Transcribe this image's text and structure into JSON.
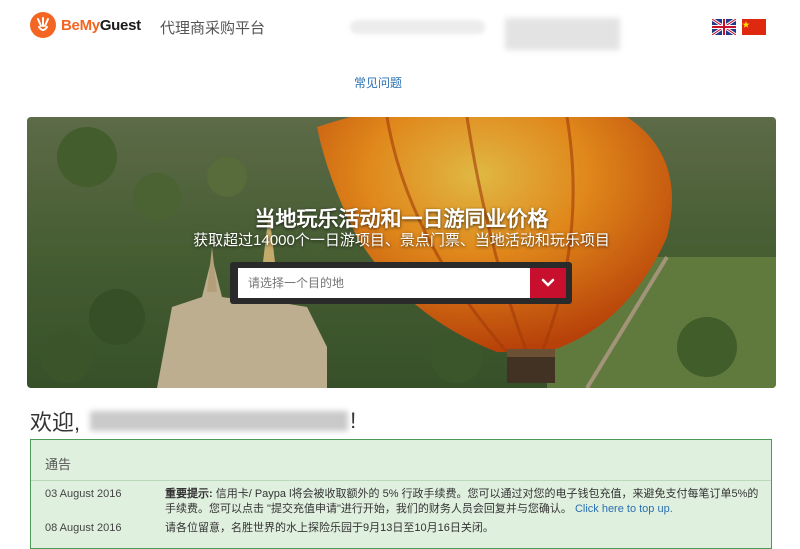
{
  "header": {
    "logo_be": "BeMy",
    "logo_guest": "Guest",
    "platform_title": "代理商采购平台",
    "languages": [
      "english-flag",
      "chinese-flag"
    ]
  },
  "nav": {
    "faq": "常见问题"
  },
  "hero": {
    "title": "当地玩乐活动和一日游同业价格",
    "subtitle": "获取超过14000个一日游项目、景点门票、当地活动和玩乐项目",
    "search_placeholder": "请选择一个目的地"
  },
  "welcome": {
    "prefix": "欢迎,",
    "suffix": "!"
  },
  "notice": {
    "title": "通告",
    "items": [
      {
        "date": "03 August 2016",
        "label": "重要提示:",
        "text": " 信用卡/ Paypa l将会被收取额外的 5% 行政手续费。您可以通过对您的电子钱包充值，来避免支付每笔订单5%的手续费。您可以点击 \"提交充值申请\"进行开始，我们的财务人员会回复并与您确认。",
        "link": "Click here to top up."
      },
      {
        "date": "08 August 2016",
        "text": "请各位留意，名胜世界的水上探险乐园于9月13日至10月16日关闭。"
      }
    ]
  },
  "colors": {
    "brand_orange": "#f26522",
    "search_button": "#c8102e",
    "notice_bg": "#e0f0df",
    "notice_border": "#4c9a55",
    "link": "#2a6fb2"
  }
}
